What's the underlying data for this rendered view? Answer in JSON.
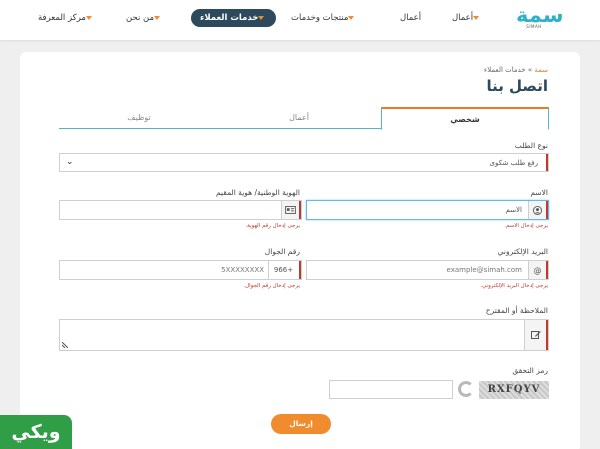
{
  "brand": {
    "logo_text": "سمة",
    "logo_sub": "SIMAH"
  },
  "nav": {
    "items": [
      {
        "label": "أعمال",
        "has_dropdown": true,
        "active": false
      },
      {
        "label": "أعمال",
        "has_dropdown": false,
        "active": false
      },
      {
        "label": "منتجات وخدمات",
        "has_dropdown": true,
        "active": false
      },
      {
        "label": "خدمات العملاء",
        "has_dropdown": true,
        "active": true
      },
      {
        "label": "من نحن",
        "has_dropdown": true,
        "active": false
      },
      {
        "label": "مركز المعرفة",
        "has_dropdown": true,
        "active": false
      }
    ],
    "accent": "#f08c2e",
    "active_bg": "#2c4a5c"
  },
  "breadcrumb": {
    "home": "سمة",
    "sep": " » ",
    "current": "خدمات العملاء"
  },
  "page_title": "اتصل بنا",
  "tabs": [
    {
      "label": "شخصي",
      "active": true
    },
    {
      "label": "أعمال",
      "active": false
    },
    {
      "label": "توظيف",
      "active": false
    }
  ],
  "form": {
    "request_type": {
      "label": "نوع الطلب",
      "value": "رفع طلب شكوى"
    },
    "name": {
      "label": "الاسم",
      "value": "الاسم",
      "hint": "يرجى إدخال الاسم.",
      "icon": "user-icon"
    },
    "national_id": {
      "label": "الهوية الوطنية/ هوية المقيم",
      "value": "",
      "hint": "يرجى إدخال رقم الهوية.",
      "icon": "id-card-icon"
    },
    "email": {
      "label": "البريد الإلكتروني",
      "placeholder": "example@simah.com",
      "hint": "يرجى إدخال البريد الإلكتروني.",
      "icon": "at-icon",
      "icon_glyph": "@"
    },
    "mobile": {
      "label": "رقم الجوال",
      "prefix": "966+",
      "placeholder": "5XXXXXXXX",
      "hint": "يرجى إدخال رقم الجوال."
    },
    "notes": {
      "label": "الملاحظة أو المقترح",
      "icon": "edit-icon"
    },
    "captcha": {
      "label": "رمز التحقق",
      "code": "RXFQYV",
      "value": ""
    },
    "submit_label": "إرسال"
  },
  "watermark": "ويكي",
  "colors": {
    "error": "#c0392b",
    "teal": "#4fb6c9",
    "brand": "#2fb1c7"
  }
}
